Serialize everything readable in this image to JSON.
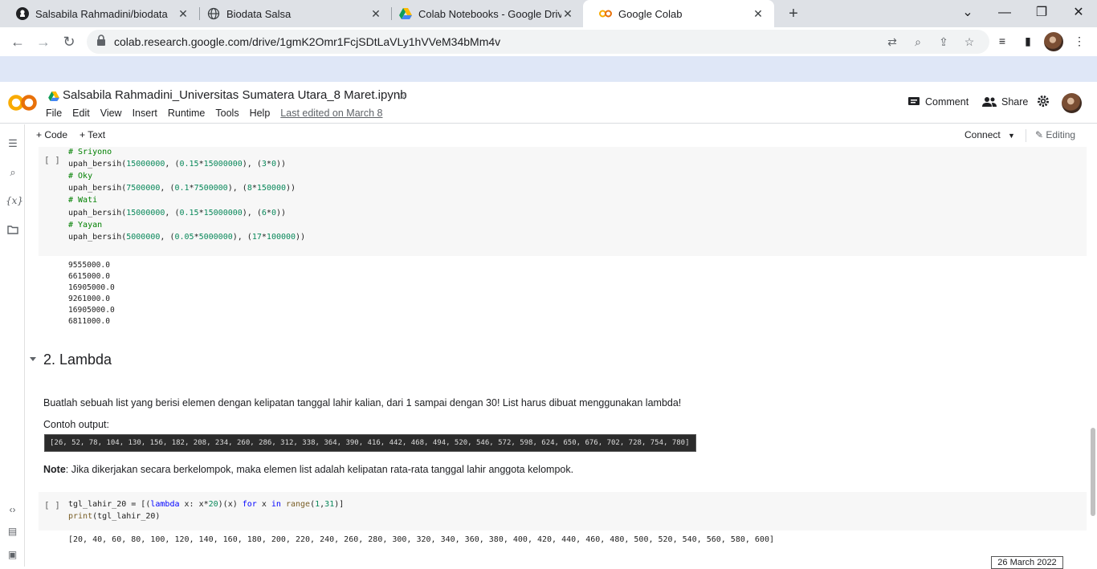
{
  "browser": {
    "tabs": [
      {
        "label": "Salsabila Rahmadini/biodata",
        "icon": "github-icon"
      },
      {
        "label": "Biodata Salsa",
        "icon": "globe-icon"
      },
      {
        "label": "Colab Notebooks - Google Drive",
        "icon": "google-drive-icon"
      },
      {
        "label": "Google Colab",
        "icon": "colab-icon"
      }
    ],
    "close_glyph": "✕",
    "new_tab_glyph": "+",
    "url": "colab.research.google.com/drive/1gmK2Omr1FcjSDtLaVLy1hVVeM34bMm4v"
  },
  "colab": {
    "file_title": "Salsabila Rahmadini_Universitas Sumatera Utara_8 Maret.ipynb",
    "menu": [
      "File",
      "Edit",
      "View",
      "Insert",
      "Runtime",
      "Tools",
      "Help"
    ],
    "last_edited": "Last edited on March 8",
    "comment_label": "Comment",
    "share_label": "Share",
    "add_code_label": "+ Code",
    "add_text_label": "+ Text",
    "connect_label": "Connect",
    "editing_label": "Editing"
  },
  "cell1": {
    "run_bracket": "[ ]",
    "output": [
      "9555000.0",
      "6615000.0",
      "16905000.0",
      "9261000.0",
      "16905000.0",
      "6811000.0"
    ]
  },
  "section": {
    "heading": "2. Lambda",
    "instruction": "Buatlah sebuah list yang berisi elemen dengan kelipatan tanggal lahir kalian, dari 1 sampai dengan 30! List harus dibuat menggunakan lambda!",
    "example_label": "Contoh output:",
    "example_output": "[26, 52, 78, 104, 130, 156, 182, 208, 234, 260, 286, 312, 338, 364, 390, 416, 442, 468, 494, 520, 546, 572, 598, 624, 650, 676, 702, 728, 754, 780]",
    "note_bold": "Note",
    "note_text": ": Jika dikerjakan secara berkelompok, maka elemen list adalah kelipatan rata-rata tanggal lahir anggota kelompok."
  },
  "cell2": {
    "run_bracket": "[ ]",
    "output": "[20, 40, 60, 80, 100, 120, 140, 160, 180, 200, 220, 240, 260, 280, 300, 320, 340, 360, 380, 400, 420, 440, 460, 480, 500, 520, 540, 560, 580, 600]"
  },
  "taskbar": {
    "date": "26 March 2022"
  },
  "colors": {
    "tabstrip": "#dee1e6",
    "bookmark_bar": "#dfe7f7",
    "code_bg": "#f7f7f7",
    "colab_orange": "#f9ab00"
  }
}
